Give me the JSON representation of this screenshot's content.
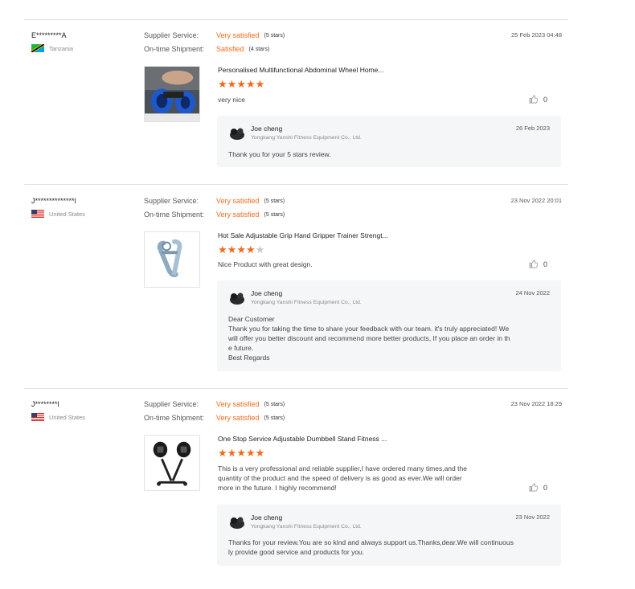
{
  "labels": {
    "supplier_service": "Supplier Service:",
    "on_time_shipment": "On-time Shipment:"
  },
  "colors": {
    "accent": "#f26b1d",
    "reply_bg": "#f5f6f8",
    "divider": "#e1e1e1"
  },
  "reviews": [
    {
      "buyer": "E*********A",
      "country": "Tanzania",
      "country_flag_icon": "tanzania-flag-icon",
      "date": "25 Feb 2023 04:48",
      "supplier_service": {
        "value": "Very satisfied",
        "stars": "(5 stars)"
      },
      "on_time_shipment": {
        "value": "Satisfied",
        "stars": "(4 stars)"
      },
      "product_title": "Personalised Multifunctional Abdominal Wheel Home...",
      "product_image_icon": "abdominal-wheel-image",
      "rating": 5,
      "comment": "very nice",
      "likes": "0",
      "reply": {
        "name": "Joe cheng",
        "company": "Yongkang Yanshi Fitness Equipment Co., Ltd.",
        "date": "26 Feb 2023",
        "text": "Thank you for your 5 stars review."
      }
    },
    {
      "buyer": "J**************l",
      "country": "United States",
      "country_flag_icon": "us-flag-icon",
      "date": "23 Nov 2022 20:01",
      "supplier_service": {
        "value": "Very satisfied",
        "stars": "(5 stars)"
      },
      "on_time_shipment": {
        "value": "Very satisfied",
        "stars": "(5 stars)"
      },
      "product_title": "Hot Sale Adjustable Grip Hand Gripper Trainer Strengt...",
      "product_image_icon": "hand-gripper-image",
      "rating": 4,
      "comment": "Nice Product with great design.",
      "likes": "0",
      "reply": {
        "name": "Joe cheng",
        "company": "Yongkang Yanshi Fitness Equipment Co., Ltd.",
        "date": "24 Nov 2022",
        "text_lines": [
          "Dear Customer",
          "Thank you for taking the time to share your feedback with our team. it's truly appreciated! We",
          "will offer you better discount and recommend more better products, If you place an order in th",
          "e future.",
          "Best Regards"
        ]
      }
    },
    {
      "buyer": "J********l",
      "country": "United States",
      "country_flag_icon": "us-flag-icon",
      "date": "23 Nov 2022 18:29",
      "supplier_service": {
        "value": "Very satisfied",
        "stars": "(5 stars)"
      },
      "on_time_shipment": {
        "value": "Very satisfied",
        "stars": "(5 stars)"
      },
      "product_title": "One Stop Service Adjustable Dumbbell Stand Fitness ...",
      "product_image_icon": "dumbbell-stand-image",
      "rating": 5,
      "comment_lines": [
        "This is a very professional and reliable supplier,I have ordered many times,and the",
        "quantity of the product and the speed of delivery is as good as ever.We will order",
        "more in the future. I highly recommend!"
      ],
      "likes": "0",
      "reply": {
        "name": "Joe cheng",
        "company": "Yongkang Yanshi Fitness Equipment Co., Ltd.",
        "date": "23 Nov 2022",
        "text_lines": [
          "Thanks for your review.You are so kind and always support us.Thanks,dear.We will continuous",
          "ly provide good service and products for you."
        ]
      }
    }
  ]
}
